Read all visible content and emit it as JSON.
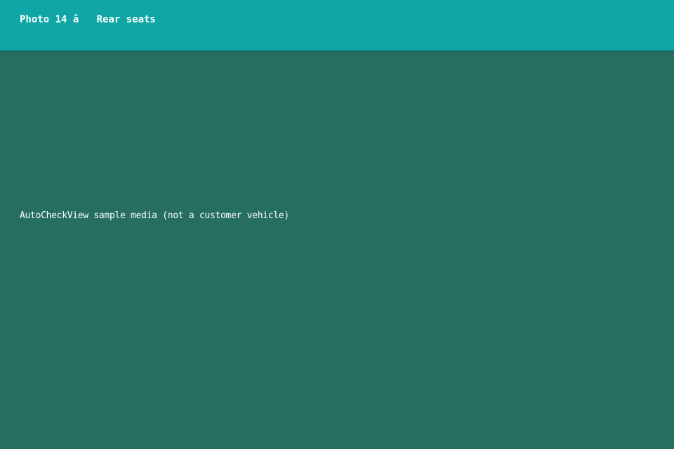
{
  "header": {
    "title": "Photo 14 â   Rear seats"
  },
  "media": {
    "caption": "AutoCheckView sample media (not a customer vehicle)"
  },
  "colors": {
    "header_background": "#10a6a6",
    "content_background": "#266e62",
    "text": "#ffffff"
  }
}
